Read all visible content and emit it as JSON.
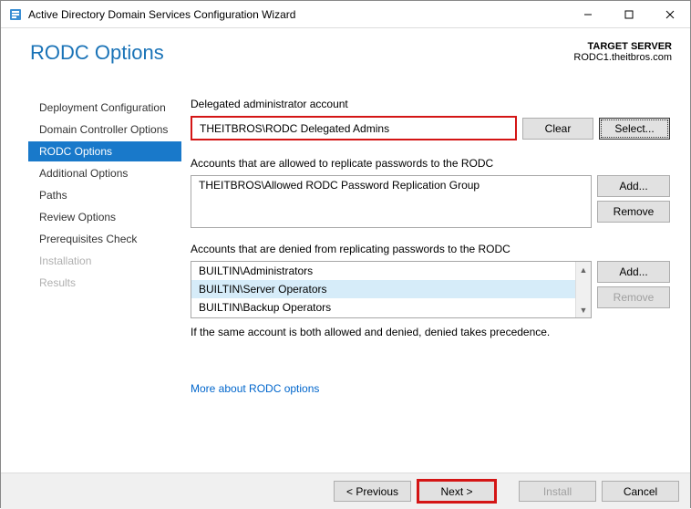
{
  "window": {
    "title": "Active Directory Domain Services Configuration Wizard"
  },
  "header": {
    "page_title": "RODC Options",
    "target_label": "TARGET SERVER",
    "target_value": "RODC1.theitbros.com"
  },
  "sidebar": {
    "items": [
      {
        "label": "Deployment Configuration",
        "state": "normal"
      },
      {
        "label": "Domain Controller Options",
        "state": "normal"
      },
      {
        "label": "RODC Options",
        "state": "active"
      },
      {
        "label": "Additional Options",
        "state": "normal"
      },
      {
        "label": "Paths",
        "state": "normal"
      },
      {
        "label": "Review Options",
        "state": "normal"
      },
      {
        "label": "Prerequisites Check",
        "state": "normal"
      },
      {
        "label": "Installation",
        "state": "disabled"
      },
      {
        "label": "Results",
        "state": "disabled"
      }
    ]
  },
  "main": {
    "delegated_label": "Delegated administrator account",
    "delegated_value": "THEITBROS\\RODC Delegated Admins",
    "clear_btn": "Clear",
    "select_btn": "Select...",
    "allowed_label": "Accounts that are allowed to replicate passwords to the RODC",
    "allowed_items": [
      "THEITBROS\\Allowed RODC Password Replication Group"
    ],
    "add_btn": "Add...",
    "remove_btn": "Remove",
    "denied_label": "Accounts that are denied from replicating passwords to the RODC",
    "denied_items": [
      "BUILTIN\\Administrators",
      "BUILTIN\\Server Operators",
      "BUILTIN\\Backup Operators"
    ],
    "denied_selected_index": 1,
    "note": "If the same account is both allowed and denied, denied takes precedence.",
    "more_link": "More about RODC options"
  },
  "footer": {
    "previous": "< Previous",
    "next": "Next >",
    "install": "Install",
    "cancel": "Cancel"
  }
}
